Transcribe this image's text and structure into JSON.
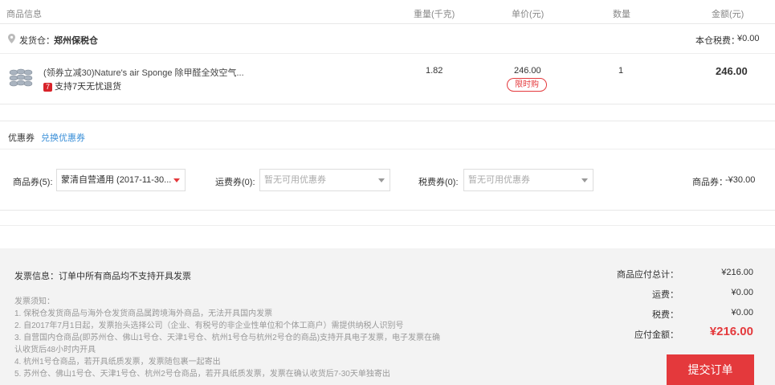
{
  "header": {
    "col_product": "商品信息",
    "col_weight": "重量(千克)",
    "col_price": "单价(元)",
    "col_qty": "数量",
    "col_amount": "金额(元)"
  },
  "warehouse": {
    "label": "发货仓：",
    "name": "郑州保税仓",
    "tax_label": "本仓税费：",
    "tax_value": "¥0.00"
  },
  "item": {
    "title": "(领券立减30)Nature's air Sponge 除甲醛全效空气...",
    "return_badge": "7",
    "return_text": "支持7天无忧退货",
    "weight": "1.82",
    "price": "246.00",
    "promo_tag": "限时购",
    "qty": "1",
    "amount": "246.00"
  },
  "coupon": {
    "title": "优惠券",
    "exchange_link": "兑换优惠券",
    "product_label": "商品券(5):",
    "product_value": "蒙清自营通用 (2017-11-30...",
    "shipping_label": "运费券(0):",
    "shipping_placeholder": "暂无可用优惠券",
    "tax_label": "税费券(0):",
    "tax_placeholder": "暂无可用优惠券",
    "discount_label": "商品券：",
    "discount_value": "-¥30.00"
  },
  "invoice": {
    "info": "发票信息：订单中所有商品均不支持开具发票",
    "notes_title": "发票须知：",
    "notes": [
      "1. 保税仓发货商品与海外仓发货商品属跨境海外商品，无法开具国内发票",
      "2. 自2017年7月1日起，发票抬头选择公司（企业、有税号的非企业性单位和个体工商户）需提供纳税人识别号",
      "3. 自营国内仓商品(即苏州仓、佛山1号仓、天津1号仓、杭州1号仓与杭州2号仓的商品)支持开具电子发票，电子发票在确",
      "认收货后48小时内开具",
      "4. 杭州1号仓商品，若开具纸质发票，发票随包裹一起寄出",
      "5. 苏州仓、佛山1号仓、天津1号仓、杭州2号仓商品，若开具纸质发票，发票在确认收货后7-30天单独寄出"
    ]
  },
  "summary": {
    "subtotal_label": "商品应付总计：",
    "subtotal_value": "¥216.00",
    "shipping_label": "运费：",
    "shipping_value": "¥0.00",
    "tax_label": "税费：",
    "tax_value": "¥0.00",
    "total_label": "应付金额：",
    "total_value": "¥216.00",
    "submit_label": "提交订单"
  },
  "colors": {
    "accent_red": "#e4393c",
    "link_blue": "#3a8fd8"
  },
  "icons": [
    "location-pin-icon",
    "product-thumbnail",
    "dropdown-arrow-icon"
  ]
}
